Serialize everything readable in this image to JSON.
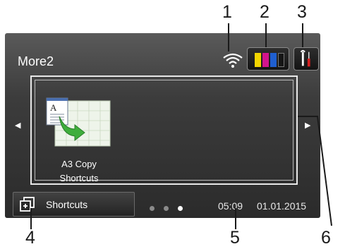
{
  "header": {
    "title": "More2"
  },
  "toolbar": {
    "wifi_icon": "wifi-icon",
    "ink_icon": "ink-cartridges-icon",
    "settings_icon": "settings-tools-icon"
  },
  "ink_colors": [
    "#f2d400",
    "#d4148c",
    "#1f5fd0",
    "#151515"
  ],
  "app": {
    "label_line1": "A3 Copy",
    "label_line2": "Shortcuts",
    "icon": "a3-copy-shortcut-icon"
  },
  "nav": {
    "left_icon": "arrow-left-icon",
    "right_icon": "arrow-right-icon"
  },
  "footer": {
    "shortcuts_label": "Shortcuts",
    "time": "05:09",
    "date": "01.01.2015",
    "page_count": 3,
    "active_page": 3
  },
  "callouts": [
    "1",
    "2",
    "3",
    "4",
    "5",
    "6"
  ]
}
